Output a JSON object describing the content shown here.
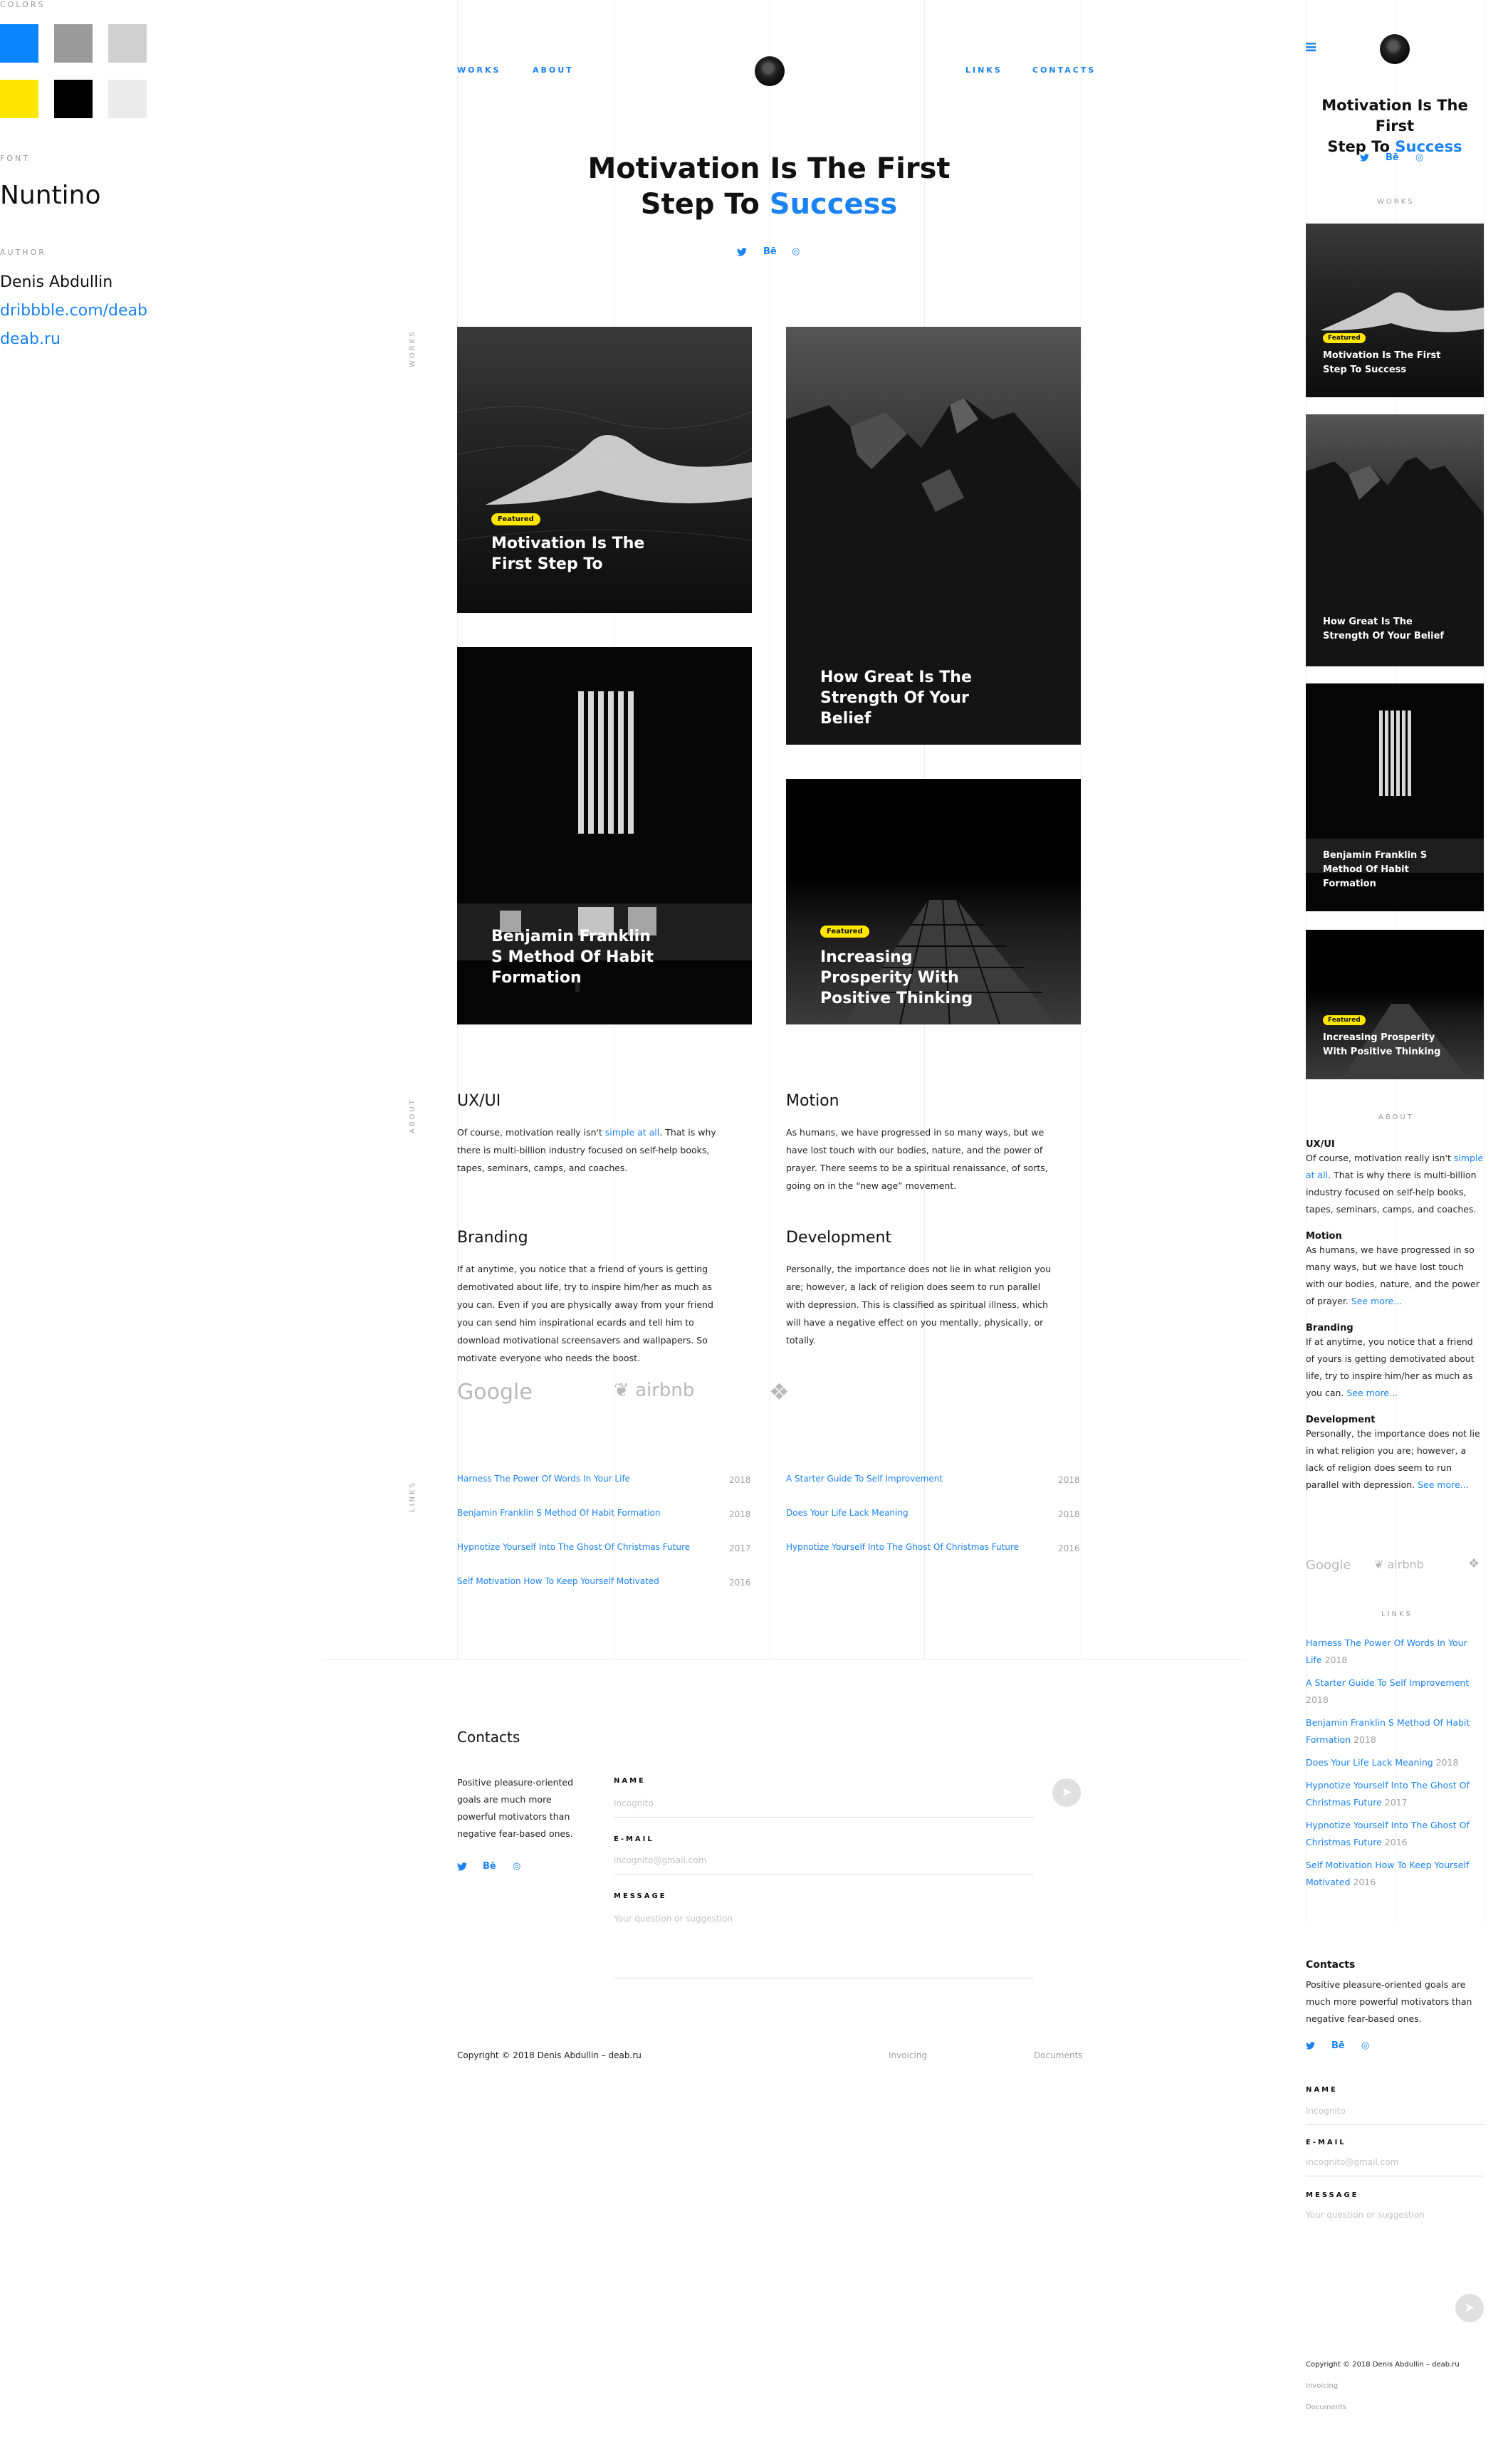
{
  "styleguide": {
    "colors_label": "COLORS",
    "colors": [
      "#0a84ff",
      "#9b9b9b",
      "#d0d0d0",
      "#ffe600",
      "#000000",
      "#ebebeb"
    ],
    "font_label": "FONT",
    "font_name": "Nuntino",
    "author_label": "AUTHOR",
    "author_name": "Denis Abdullin",
    "author_link1": "dribbble.com/deab",
    "author_link2": "deab.ru"
  },
  "nav": {
    "works": "WORKS",
    "about": "ABOUT",
    "links": "LINKS",
    "contacts": "CONTACTS"
  },
  "hero": {
    "line1": "Motivation Is The First",
    "line2_pre": "Step To ",
    "line2_accent": "Success"
  },
  "social": {
    "twitter": "🐦",
    "behance": "Bē",
    "instagram": "◎"
  },
  "section_labels": {
    "works": "WORKS",
    "about": "ABOUT",
    "links": "LINKS"
  },
  "cards": {
    "badge": "Featured",
    "c1": "Motivation Is The First Step To",
    "c2": "How Great Is The Strength Of Your Belief",
    "c3": "Benjamin Franklin S Method Of Habit Formation",
    "c4": "Increasing Prosperity With Positive Thinking",
    "m1": "Motivation Is The First Step To Success",
    "m2": "How Great Is The Strength Of Your Belief",
    "m3": "Benjamin Franklin S Method Of Habit Formation",
    "m4": "Increasing Prosperity With Positive Thinking"
  },
  "about": {
    "uxui_title": "UX/UI",
    "uxui_pre": "Of course, motivation really isn't ",
    "uxui_link": "simple at all",
    "uxui_post": ". That is why there is multi-billion industry focused on self-help books, tapes, seminars, camps, and coaches.",
    "motion_title": "Motion",
    "motion_text": "As humans, we have progressed in so many ways, but we have lost touch with our bodies, nature, and the power of prayer. There seems to be a spiritual renaissance, of sorts, going on in the “new age” movement.",
    "branding_title": "Branding",
    "branding_text": "If at anytime, you notice that a friend of yours is getting demotivated about life, try to inspire him/her as much as you can. Even if you are physically away from your friend you can send him inspirational ecards and tell him to download motivational screensavers and wallpapers. So motivate everyone who needs the boost.",
    "development_title": "Development",
    "development_text": "Personally, the importance does not lie in what religion you are; however, a lack of religion does seem to run parallel with depression. This is classified as spiritual illness, which will have a negative effect on you mentally, physically, or totally."
  },
  "clients": {
    "google": "Google",
    "airbnb": "airbnb",
    "dropbox": "❖"
  },
  "links": {
    "left": [
      {
        "title": "Harness The Power Of Words In Your Life",
        "year": "2018"
      },
      {
        "title": "Benjamin Franklin S Method Of Habit Formation",
        "year": "2018"
      },
      {
        "title": "Hypnotize Yourself Into The Ghost Of Christmas Future",
        "year": "2017"
      },
      {
        "title": "Self Motivation How To Keep Yourself Motivated",
        "year": "2016"
      }
    ],
    "right": [
      {
        "title": "A Starter Guide To Self Improvement",
        "year": "2018"
      },
      {
        "title": "Does Your Life Lack Meaning",
        "year": "2018"
      },
      {
        "title": "Hypnotize Yourself Into The Ghost Of Christmas Future",
        "year": "2016"
      }
    ]
  },
  "contacts": {
    "title": "Contacts",
    "text": "Positive pleasure-oriented goals are much more powerful motivators than negative fear-based ones.",
    "name_label": "NAME",
    "name_ph": "Incognito",
    "email_label": "E-MAIL",
    "email_ph": "incognito@gmail.com",
    "message_label": "MESSAGE",
    "message_ph": "Your question or suggestion",
    "send": "➤"
  },
  "footer": {
    "copyright": "Copyright © 2018 Denis Abdullin – deab.ru",
    "invoicing": "Invoicing",
    "documents": "Documents"
  },
  "mobile": {
    "menu_icon": "≡",
    "works_label": "WORKS",
    "about_label": "ABOUT",
    "links_label": "LINKS",
    "uxui_title": "UX/UI",
    "uxui_pre": "Of course, motivation really isn't ",
    "uxui_link": "simple at all",
    "uxui_post": ". That is why there is multi-billion industry focused on self-help books, tapes, seminars, camps, and coaches.",
    "motion_title": "Motion",
    "motion_text": "As humans, we have progressed in so many ways, but we have lost touch with our bodies, nature, and the power of prayer. ",
    "branding_title": "Branding",
    "branding_text": "If at anytime, you notice that a friend of yours is getting demotivated about life, try to inspire him/her as much as you can. ",
    "development_title": "Development",
    "development_text": "Personally, the importance does not lie in what religion you are; however, a lack of religion does seem to run parallel with depression. ",
    "see_more": "See more...",
    "links": [
      {
        "title": "Harness The Power Of Words In Your Life",
        "year": "2018"
      },
      {
        "title": "A Starter Guide To Self Improvement",
        "year": "2018"
      },
      {
        "title": "Benjamin Franklin S Method Of Habit Formation",
        "year": "2018"
      },
      {
        "title": "Does Your Life Lack Meaning",
        "year": "2018"
      },
      {
        "title": "Hypnotize Yourself Into The Ghost Of Christmas Future",
        "year": "2017"
      },
      {
        "title": "Hypnotize Yourself Into The Ghost Of Christmas Future",
        "year": "2016"
      },
      {
        "title": "Self Motivation How To Keep Yourself Motivated",
        "year": "2016"
      }
    ],
    "contacts_title": "Contacts",
    "contacts_text": "Positive pleasure-oriented goals are much more powerful motivators than negative fear-based ones.",
    "copyright": "Copyright © 2018 Denis Abdullin – deab.ru",
    "invoicing": "Invoicing",
    "documents": "Documents"
  }
}
